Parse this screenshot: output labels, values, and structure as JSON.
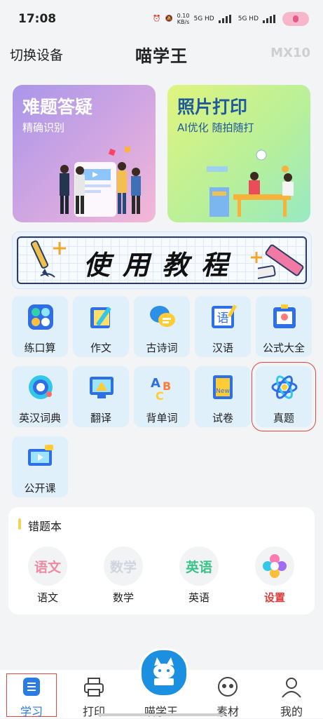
{
  "status": {
    "time": "17:08",
    "net_speed": "0.10",
    "net_unit": "KB/s",
    "sig1": "5G HD",
    "sig2": "5G HD"
  },
  "header": {
    "switch_label": "切换设备",
    "title": "喵学王",
    "model": "MX10"
  },
  "cards": [
    {
      "title": "难题答疑",
      "subtitle": "精确识别"
    },
    {
      "title": "照片打印",
      "subtitle": "AI优化 随拍随打"
    }
  ],
  "tutorial": {
    "label": "使用教程"
  },
  "tools": [
    {
      "label": "练口算",
      "icon": "calculator-icon"
    },
    {
      "label": "作文",
      "icon": "book-pen-icon"
    },
    {
      "label": "古诗词",
      "icon": "chat-bubble-icon"
    },
    {
      "label": "汉语",
      "icon": "chinese-char-icon"
    },
    {
      "label": "公式大全",
      "icon": "formula-card-icon"
    },
    {
      "label": "英汉词典",
      "icon": "dictionary-icon"
    },
    {
      "label": "翻译",
      "icon": "translate-icon"
    },
    {
      "label": "背单词",
      "icon": "abc-letters-icon"
    },
    {
      "label": "试卷",
      "icon": "exam-paper-icon"
    },
    {
      "label": "真题",
      "icon": "atom-icon"
    },
    {
      "label": "公开课",
      "icon": "video-screen-icon"
    }
  ],
  "wrong_book": {
    "title": "错题本",
    "subjects": [
      {
        "label": "语文",
        "badge": "语文",
        "color": "#f08aa0"
      },
      {
        "label": "数学",
        "badge": "数学",
        "color": "#cfd4df"
      },
      {
        "label": "英语",
        "badge": "英语",
        "color": "#3ac48a"
      },
      {
        "label": "设置",
        "badge": "",
        "color": "#e03b3b"
      }
    ]
  },
  "tabs": [
    {
      "label": "学习",
      "icon": "study-icon"
    },
    {
      "label": "打印",
      "icon": "printer-icon"
    },
    {
      "label": "喵学王",
      "icon": "cat-book-icon"
    },
    {
      "label": "素材",
      "icon": "quote-icon"
    },
    {
      "label": "我的",
      "icon": "person-icon"
    }
  ],
  "colors": {
    "accent": "#2a7be4",
    "tile_bg": "#dff0fb",
    "highlight": "#e04747"
  }
}
